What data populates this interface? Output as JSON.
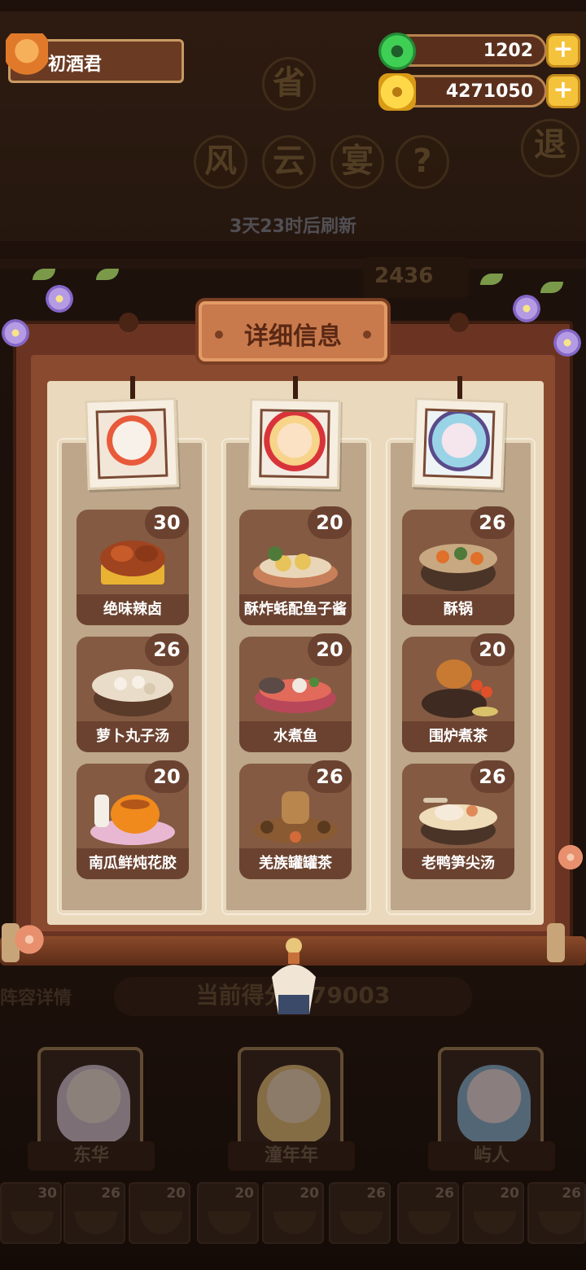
{
  "player": {
    "name": "初酒君"
  },
  "resources": {
    "jade": {
      "value": "1202",
      "icon": "jade-icon"
    },
    "coins": {
      "value": "4271050",
      "icon": "coin-icon"
    },
    "plus_label": "+"
  },
  "background": {
    "province_badge": "省",
    "title_chars": [
      "风",
      "云",
      "宴"
    ],
    "help_label": "?",
    "exit_label": "退",
    "refresh_text": "3天23时后刷新",
    "score_partial": "2436",
    "current_score_text": "当前得分 079003",
    "lineup_label": "阵容详情"
  },
  "panel": {
    "title": "详细信息",
    "columns": [
      {
        "character": "东华",
        "portrait_colors": [
          "#f4f0ea",
          "#e85a3a"
        ],
        "dishes": [
          {
            "name": "绝味辣卤",
            "score": "30"
          },
          {
            "name": "萝卜丸子汤",
            "score": "26"
          },
          {
            "name": "南瓜鲜炖花胶",
            "score": "20"
          }
        ]
      },
      {
        "character": "潼年年",
        "portrait_colors": [
          "#f7d489",
          "#d9333a"
        ],
        "dishes": [
          {
            "name": "酥炸蚝配鱼子酱",
            "score": "20"
          },
          {
            "name": "水煮鱼",
            "score": "20"
          },
          {
            "name": "羌族罐罐茶",
            "score": "26"
          }
        ]
      },
      {
        "character": "屿人",
        "portrait_colors": [
          "#9ad3e6",
          "#5a4a8a"
        ],
        "dishes": [
          {
            "name": "酥锅",
            "score": "26"
          },
          {
            "name": "围炉煮茶",
            "score": "20"
          },
          {
            "name": "老鸭笋尖汤",
            "score": "26"
          }
        ]
      }
    ]
  },
  "bottom_lineup": {
    "characters": [
      "东华",
      "潼年年",
      "屿人"
    ],
    "dish_scores": [
      "30",
      "26",
      "20",
      "20",
      "20",
      "26",
      "26",
      "20",
      "26"
    ]
  },
  "colors": {
    "accent_gold": "#f5c33b",
    "panel_wood": "#6b3422",
    "paper": "#ead9bd",
    "card": "#845a42"
  }
}
